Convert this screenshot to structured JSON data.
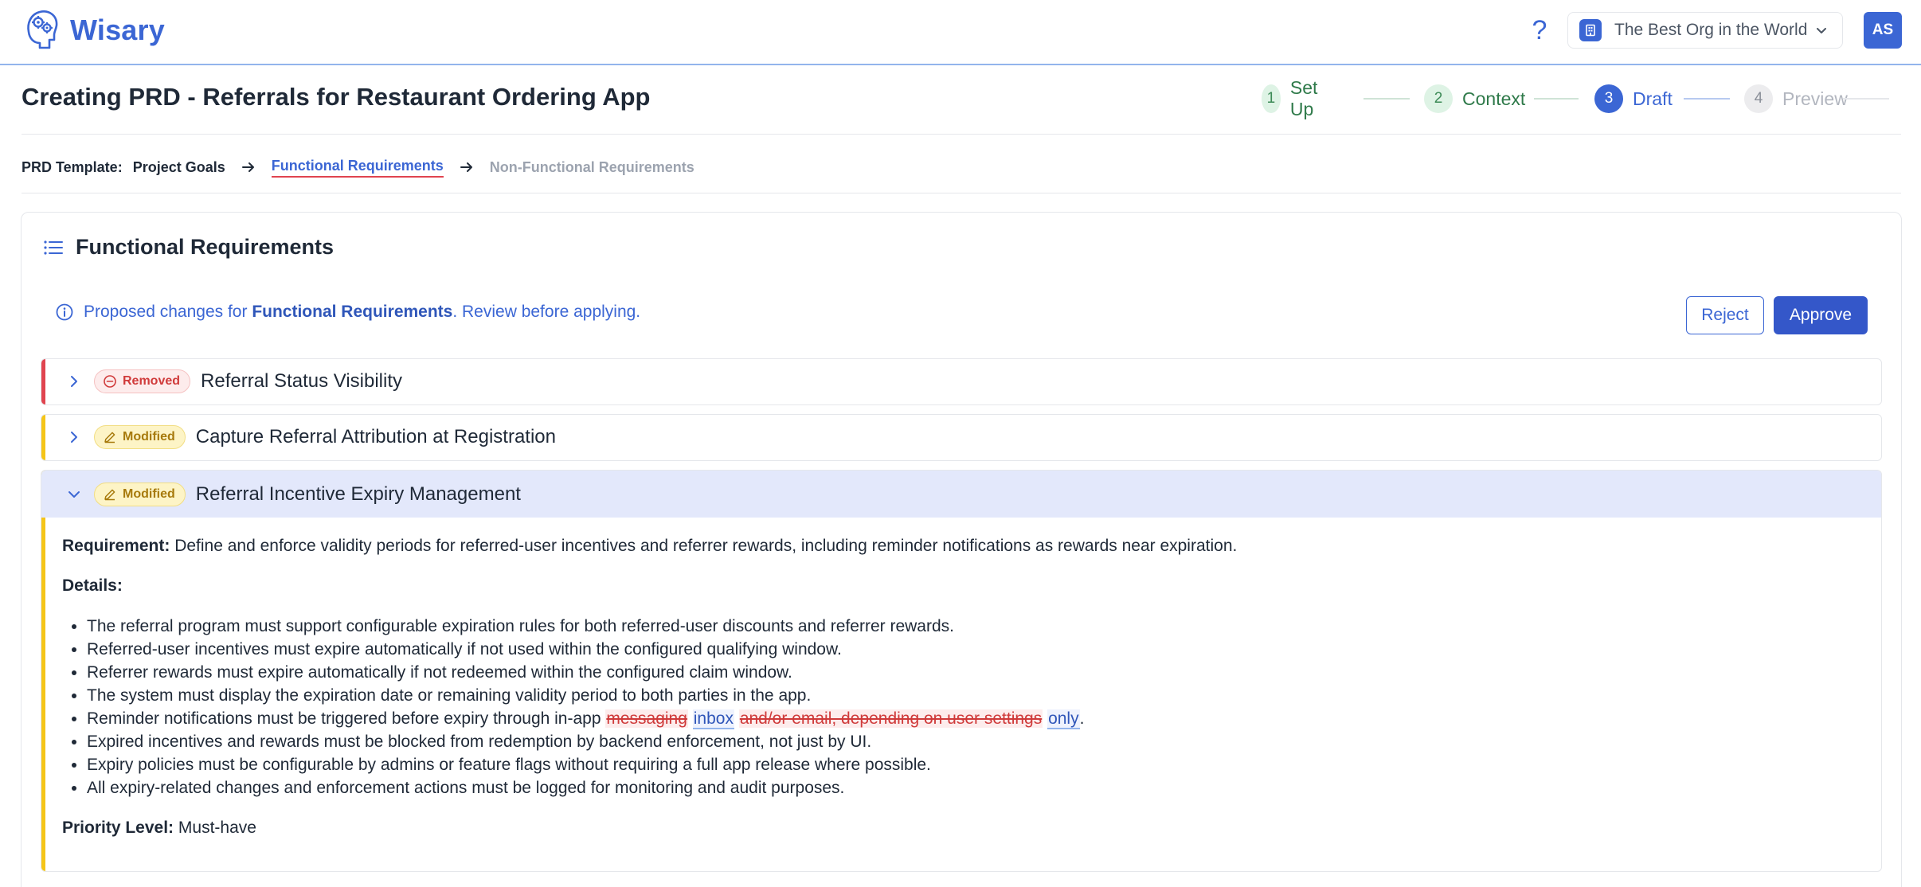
{
  "app": {
    "name": "Wisary"
  },
  "org": {
    "name": "The Best Org in the World"
  },
  "user": {
    "initials": "AS"
  },
  "page": {
    "title": "Creating PRD - Referrals for Restaurant Ordering App"
  },
  "stepper": [
    {
      "num": "1",
      "label": "Set Up",
      "state": "done"
    },
    {
      "num": "2",
      "label": "Context",
      "state": "done"
    },
    {
      "num": "3",
      "label": "Draft",
      "state": "active"
    },
    {
      "num": "4",
      "label": "Preview",
      "state": "future"
    }
  ],
  "breadcrumb": {
    "prefix": "PRD Template:",
    "items": [
      "Project Goals",
      "Functional Requirements",
      "Non-Functional Requirements"
    ]
  },
  "section": {
    "title": "Functional Requirements",
    "notice_prefix": "Proposed changes for ",
    "notice_bold": "Functional Requirements",
    "notice_suffix": ". Review before applying.",
    "reject_label": "Reject",
    "approve_label": "Approve"
  },
  "changes": [
    {
      "badge": "Removed",
      "title": "Referral Status Visibility",
      "kind": "removed",
      "expanded": false
    },
    {
      "badge": "Modified",
      "title": "Capture Referral Attribution at Registration",
      "kind": "modified",
      "expanded": false
    },
    {
      "badge": "Modified",
      "title": "Referral Incentive Expiry Management",
      "kind": "modified",
      "expanded": true,
      "requirement_label": "Requirement:",
      "requirement": " Define and enforce validity periods for referred-user incentives and referrer rewards, including reminder notifications as rewards near expiration.",
      "details_label": "Details:",
      "details": [
        "The referral program must support configurable expiration rules for both referred-user discounts and referrer rewards.",
        "Referred-user incentives must expire automatically if not used within the configured qualifying window.",
        "Referrer rewards must expire automatically if not redeemed within the configured claim window.",
        "The system must display the expiration date or remaining validity period to both parties in the app."
      ],
      "diff_line": {
        "prefix": "Reminder notifications must be triggered before expiry through in-app ",
        "deleted_1": "messaging",
        "inserted_1": "inbox",
        "deleted_2": "and/or email, depending on user settings",
        "inserted_2": "only",
        "suffix": "."
      },
      "details_after": [
        "Expired incentives and rewards must be blocked from redemption by backend enforcement, not just by UI.",
        "Expiry policies must be configurable by admins or feature flags without requiring a full app release where possible.",
        "All expiry-related changes and enforcement actions must be logged for monitoring and audit purposes."
      ],
      "priority_label": "Priority Level:",
      "priority": " Must-have"
    }
  ],
  "colors": {
    "brand": "#3b66d4",
    "removed_accent": "#e0444f",
    "modified_accent": "#f5c518",
    "expanded_header": "#e3e8fb"
  },
  "icons": [
    "brain-logo-icon",
    "help-icon",
    "org-icon",
    "chevron-down-icon",
    "arrow-right-icon",
    "list-icon",
    "info-icon",
    "chevron-right-icon",
    "minus-circle-icon",
    "pencil-icon"
  ]
}
